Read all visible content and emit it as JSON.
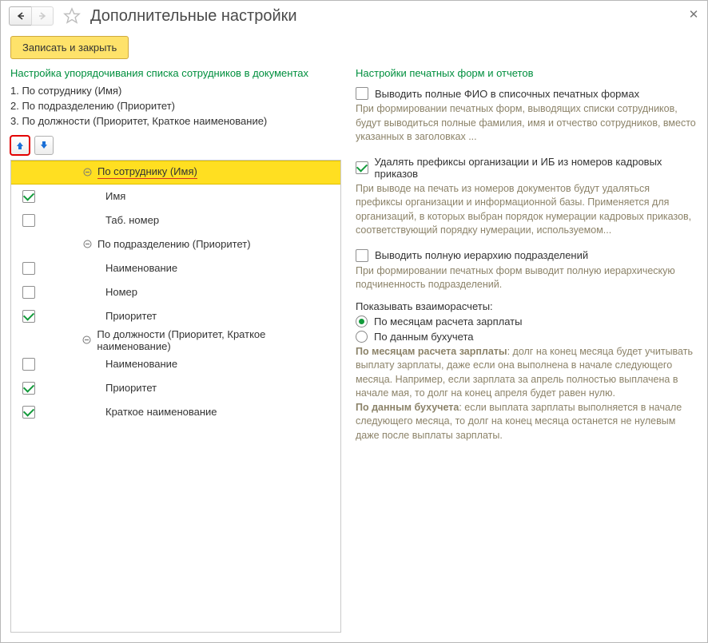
{
  "window": {
    "title": "Дополнительные настройки"
  },
  "toolbar": {
    "save_close_label": "Записать и закрыть"
  },
  "left": {
    "section_title": "Настройка упорядочивания списка сотрудников в документах",
    "order_lines": {
      "l1": "1. По сотруднику (Имя)",
      "l2": "2. По подразделению (Приоритет)",
      "l3": "3. По должности (Приоритет, Краткое наименование)"
    },
    "tree": {
      "g1": {
        "label": "По сотруднику (Имя)",
        "c1": "Имя",
        "c2": "Таб. номер"
      },
      "g2": {
        "label": "По подразделению (Приоритет)",
        "c1": "Наименование",
        "c2": "Номер",
        "c3": "Приоритет"
      },
      "g3": {
        "label": "По должности (Приоритет, Краткое наименование)",
        "c1": "Наименование",
        "c2": "Приоритет",
        "c3": "Краткое наименование"
      }
    }
  },
  "right": {
    "section_title": "Настройки печатных форм и отчетов",
    "fio_label": "Выводить полные ФИО в списочных печатных формах",
    "fio_help": "При формировании печатных форм, выводящих списки сотрудников, будут выводиться полные фамилия, имя и отчество сотрудников, вместо указанных в заголовках ...",
    "prefix_label": "Удалять префиксы организации и ИБ из номеров кадровых приказов",
    "prefix_help": "При выводе на печать из номеров документов будут удаляться префиксы организации и информационной базы. Применяется для организаций, в которых выбран порядок нумерации кадровых приказов, соответствующий порядку нумерации, используемом...",
    "hier_label": "Выводить полную иерархию подразделений",
    "hier_help": "При формировании печатных форм выводит полную иерархическую подчиненность подразделений.",
    "mutual_title": "Показывать взаиморасчеты:",
    "radio1": "По месяцам расчета зарплаты",
    "radio2": "По данным бухучета",
    "mutual_help1_bold": "По месяцам расчета зарплаты",
    "mutual_help1_rest": ": долг на конец месяца будет учитывать выплату зарплаты, даже если она выполнена в начале следующего месяца. Например, если зарплата за апрель полностью выплачена в начале мая, то долг на конец апреля будет равен нулю.",
    "mutual_help2_bold": "По данным бухучета",
    "mutual_help2_rest": ": если выплата зарплаты выполняется в начале следующего месяца, то долг на конец месяца останется не нулевым даже после выплаты зарплаты."
  }
}
